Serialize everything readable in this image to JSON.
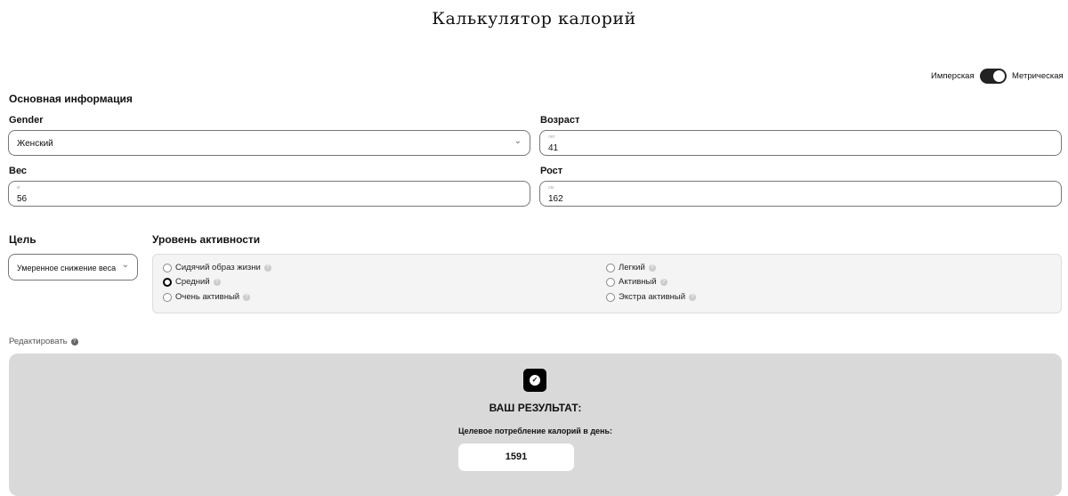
{
  "title": "Калькулятор калорий",
  "units": {
    "imperial": "Имперская",
    "metric": "Метрическая",
    "metric_selected": true
  },
  "basic": {
    "heading": "Основная информация",
    "gender": {
      "label": "Gender",
      "value": "Женский"
    },
    "age": {
      "label": "Возраст",
      "unit": "лет",
      "value": "41"
    },
    "weight": {
      "label": "Вес",
      "unit": "кг",
      "value": "56"
    },
    "height": {
      "label": "Рост",
      "unit": "см",
      "value": "162"
    }
  },
  "goal": {
    "label": "Цель",
    "value": "Умеренное снижение веса"
  },
  "activity": {
    "label": "Уровень активности",
    "options": [
      "Сидячий образ жизни",
      "Средний",
      "Очень активный",
      "Легкий",
      "Активный",
      "Экстра активный"
    ],
    "selected": "Средний"
  },
  "edit": {
    "label": "Редактировать"
  },
  "result": {
    "heading": "ВАШ РЕЗУЛЬТАТ:",
    "subtitle": "Целевое потребление калорий в день:",
    "value": "1591"
  }
}
